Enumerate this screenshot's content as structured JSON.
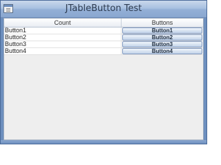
{
  "window": {
    "title": "JTableButton Test"
  },
  "table": {
    "columns": [
      "Count",
      "Buttons"
    ],
    "rows": [
      {
        "count": "Button1",
        "button": "Button1"
      },
      {
        "count": "Button2",
        "button": "Button2"
      },
      {
        "count": "Button3",
        "button": "Button3"
      },
      {
        "count": "Button4",
        "button": "Button4"
      }
    ]
  },
  "colors": {
    "titlebar": "#a9c1e1",
    "frame": "#6d8fbe",
    "content": "#eeeeee"
  },
  "icons": {
    "app": "java-window-icon"
  }
}
